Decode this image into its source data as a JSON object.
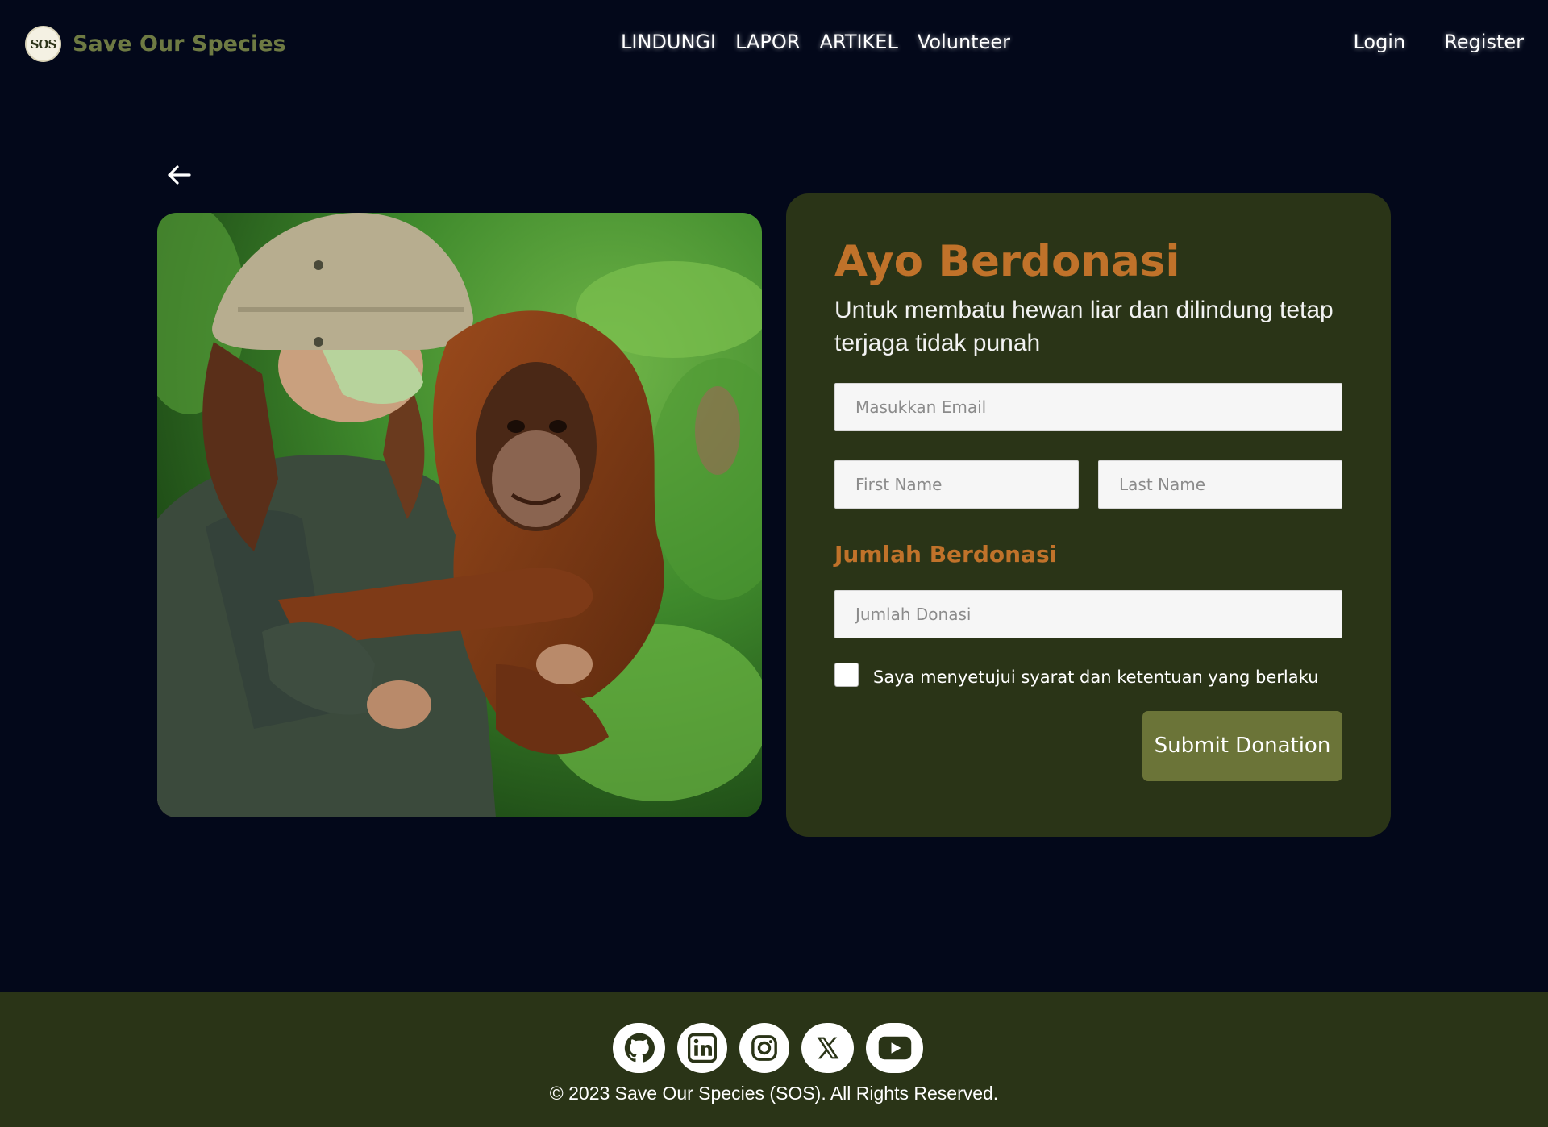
{
  "navbar": {
    "logo_text": "SOS",
    "brand_name": "Save Our Species",
    "links": [
      "LINDUNGI",
      "LAPOR",
      "ARTIKEL",
      "Volunteer"
    ],
    "login": "Login",
    "register": "Register"
  },
  "main": {
    "photo_alt": "Ranger holding a baby orangutan",
    "title": "Ayo Berdonasi",
    "subtitle": "Untuk membatu hewan liar dan dilindung tetap terjaga tidak punah",
    "email_placeholder": "Masukkan Email",
    "first_name_placeholder": "First Name",
    "last_name_placeholder": "Last Name",
    "amount_label": "Jumlah Berdonasi",
    "amount_placeholder": "Jumlah Donasi",
    "agree_label": "Saya menyetujui syarat dan ketentuan yang berlaku",
    "submit_label": "Submit Donation"
  },
  "footer": {
    "socials": [
      "github-icon",
      "linkedin-icon",
      "instagram-icon",
      "x-icon",
      "youtube-icon"
    ],
    "copyright": "© 2023 Save Our Species (SOS). All Rights Reserved."
  },
  "colors": {
    "background": "#03081a",
    "card": "#2a3417",
    "accent": "#c0722a",
    "button": "#6b7438",
    "brand": "#6e7a43"
  }
}
